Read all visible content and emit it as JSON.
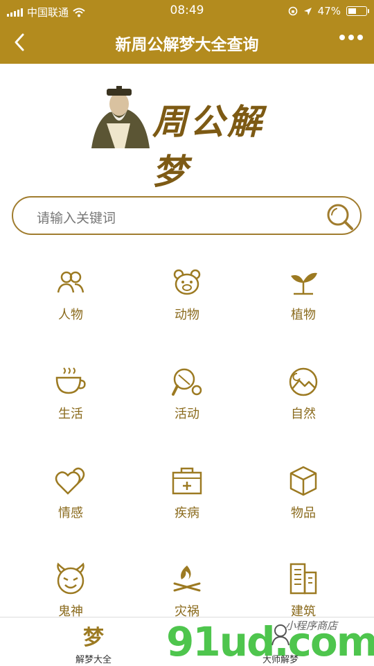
{
  "status_bar": {
    "carrier": "中国联通",
    "time": "08:49",
    "battery": "47%",
    "battery_level": 0.47
  },
  "nav": {
    "title": "新周公解梦大全查询"
  },
  "logo": {
    "text": "周公解梦"
  },
  "search": {
    "placeholder": "请输入关键词"
  },
  "categories": [
    {
      "label": "人物",
      "icon": "people-icon"
    },
    {
      "label": "动物",
      "icon": "animal-icon"
    },
    {
      "label": "植物",
      "icon": "plant-icon"
    },
    {
      "label": "生活",
      "icon": "coffee-cup-icon"
    },
    {
      "label": "活动",
      "icon": "ping-pong-icon"
    },
    {
      "label": "自然",
      "icon": "landscape-icon"
    },
    {
      "label": "情感",
      "icon": "hearts-icon"
    },
    {
      "label": "疾病",
      "icon": "medical-kit-icon"
    },
    {
      "label": "物品",
      "icon": "box-icon"
    },
    {
      "label": "鬼神",
      "icon": "devil-icon"
    },
    {
      "label": "灾祸",
      "icon": "fire-icon"
    },
    {
      "label": "建筑",
      "icon": "building-icon"
    }
  ],
  "tabbar": {
    "tabs": [
      {
        "label": "解梦大全",
        "glyph": "梦"
      },
      {
        "label": "大师解梦",
        "glyph": ""
      }
    ]
  },
  "watermark": {
    "brand": "91ud.com",
    "caption": "小程序商店"
  },
  "colors": {
    "accent": "#b38b1e",
    "icon": "#9c7a22",
    "label": "#8a6a1c"
  }
}
